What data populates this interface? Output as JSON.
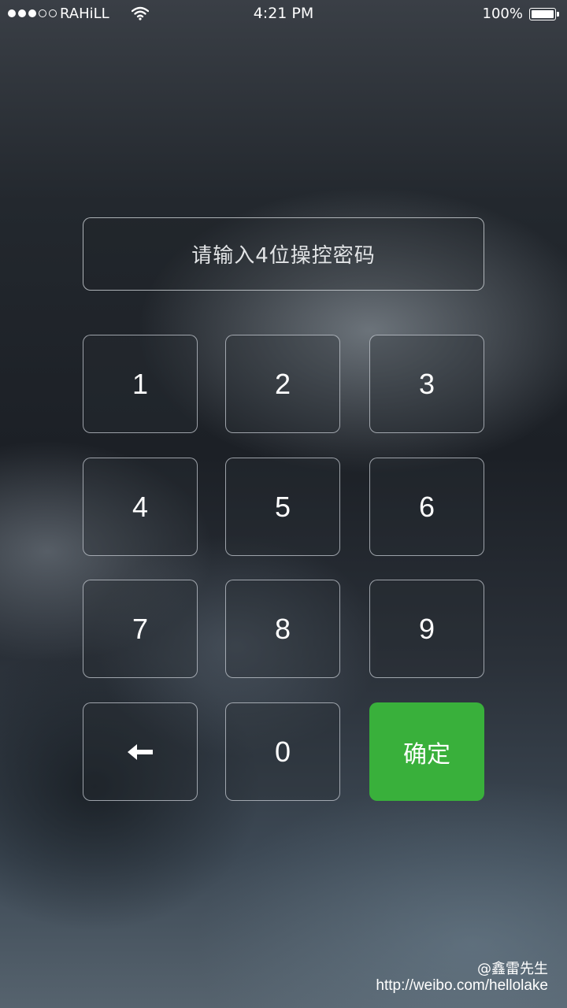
{
  "status_bar": {
    "carrier": "RAHiLL",
    "time": "4:21 PM",
    "battery": "100%",
    "signal_bars_filled": 3,
    "signal_bars_total": 5
  },
  "password_field": {
    "placeholder": "请输入4位操控密码"
  },
  "keypad": {
    "k1": "1",
    "k2": "2",
    "k3": "3",
    "k4": "4",
    "k5": "5",
    "k6": "6",
    "k7": "7",
    "k8": "8",
    "k9": "9",
    "k0": "0",
    "backspace_icon": "left-arrow-icon",
    "confirm_label": "确定"
  },
  "watermark": {
    "author": "@鑫雷先生",
    "url": "http://weibo.com/hellolake"
  },
  "colors": {
    "confirm_button": "#39b03b",
    "text": "#ffffff"
  }
}
